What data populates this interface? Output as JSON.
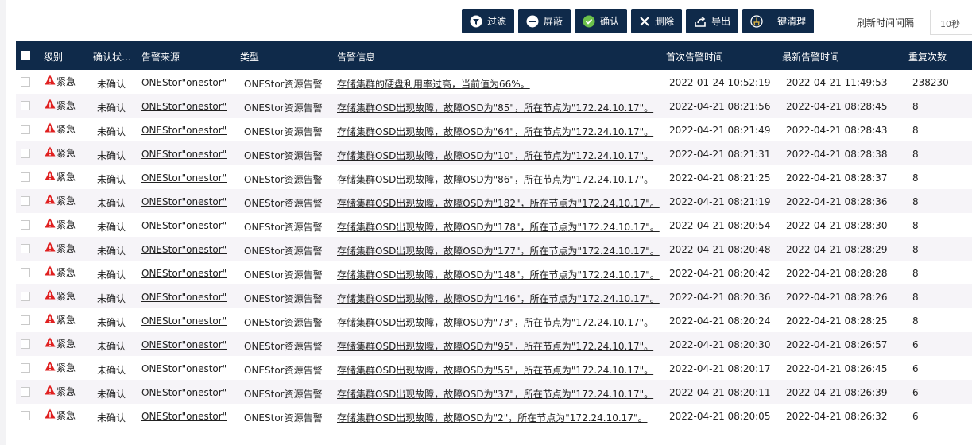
{
  "toolbar": {
    "filter_label": "过滤",
    "mask_label": "屏蔽",
    "confirm_label": "确认",
    "delete_label": "删除",
    "export_label": "导出",
    "clear_label": "一键清理",
    "refresh_label": "刷新时间间隔",
    "refresh_value": "10秒"
  },
  "colors": {
    "header_bg": "#0f2a4a",
    "button_bg": "#0f2a4a",
    "alert_red": "#e02020",
    "confirm_green": "#6cc14a"
  },
  "table": {
    "headers": {
      "level": "级别",
      "status": "确认状…",
      "source": "告警来源",
      "type": "类型",
      "msg": "告警信息",
      "first": "首次告警时间",
      "last": "最新告警时间",
      "count": "重复次数"
    },
    "rows": [
      {
        "level": "紧急",
        "status": "未确认",
        "source": "ONEStor\"onestor\"",
        "type": "ONEStor资源告警",
        "msg": "存储集群的硬盘利用率过高，当前值为66%。",
        "first": "2022-01-24 10:52:19",
        "last": "2022-04-21 11:49:53",
        "count": "238230"
      },
      {
        "level": "紧急",
        "status": "未确认",
        "source": "ONEStor\"onestor\"",
        "type": "ONEStor资源告警",
        "msg": "存储集群OSD出现故障，故障OSD为\"85\"，所在节点为\"172.24.10.17\"。",
        "first": "2022-04-21 08:21:56",
        "last": "2022-04-21 08:28:45",
        "count": "8"
      },
      {
        "level": "紧急",
        "status": "未确认",
        "source": "ONEStor\"onestor\"",
        "type": "ONEStor资源告警",
        "msg": "存储集群OSD出现故障，故障OSD为\"64\"，所在节点为\"172.24.10.17\"。",
        "first": "2022-04-21 08:21:49",
        "last": "2022-04-21 08:28:43",
        "count": "8"
      },
      {
        "level": "紧急",
        "status": "未确认",
        "source": "ONEStor\"onestor\"",
        "type": "ONEStor资源告警",
        "msg": "存储集群OSD出现故障，故障OSD为\"10\"，所在节点为\"172.24.10.17\"。",
        "first": "2022-04-21 08:21:31",
        "last": "2022-04-21 08:28:38",
        "count": "8"
      },
      {
        "level": "紧急",
        "status": "未确认",
        "source": "ONEStor\"onestor\"",
        "type": "ONEStor资源告警",
        "msg": "存储集群OSD出现故障，故障OSD为\"86\"，所在节点为\"172.24.10.17\"。",
        "first": "2022-04-21 08:21:25",
        "last": "2022-04-21 08:28:37",
        "count": "8"
      },
      {
        "level": "紧急",
        "status": "未确认",
        "source": "ONEStor\"onestor\"",
        "type": "ONEStor资源告警",
        "msg": "存储集群OSD出现故障，故障OSD为\"182\"，所在节点为\"172.24.10.17\"。",
        "first": "2022-04-21 08:21:19",
        "last": "2022-04-21 08:28:36",
        "count": "8"
      },
      {
        "level": "紧急",
        "status": "未确认",
        "source": "ONEStor\"onestor\"",
        "type": "ONEStor资源告警",
        "msg": "存储集群OSD出现故障，故障OSD为\"178\"，所在节点为\"172.24.10.17\"。",
        "first": "2022-04-21 08:20:54",
        "last": "2022-04-21 08:28:30",
        "count": "8"
      },
      {
        "level": "紧急",
        "status": "未确认",
        "source": "ONEStor\"onestor\"",
        "type": "ONEStor资源告警",
        "msg": "存储集群OSD出现故障，故障OSD为\"177\"，所在节点为\"172.24.10.17\"。",
        "first": "2022-04-21 08:20:48",
        "last": "2022-04-21 08:28:29",
        "count": "8"
      },
      {
        "level": "紧急",
        "status": "未确认",
        "source": "ONEStor\"onestor\"",
        "type": "ONEStor资源告警",
        "msg": "存储集群OSD出现故障，故障OSD为\"148\"，所在节点为\"172.24.10.17\"。",
        "first": "2022-04-21 08:20:42",
        "last": "2022-04-21 08:28:28",
        "count": "8"
      },
      {
        "level": "紧急",
        "status": "未确认",
        "source": "ONEStor\"onestor\"",
        "type": "ONEStor资源告警",
        "msg": "存储集群OSD出现故障，故障OSD为\"146\"，所在节点为\"172.24.10.17\"。",
        "first": "2022-04-21 08:20:36",
        "last": "2022-04-21 08:28:26",
        "count": "8"
      },
      {
        "level": "紧急",
        "status": "未确认",
        "source": "ONEStor\"onestor\"",
        "type": "ONEStor资源告警",
        "msg": "存储集群OSD出现故障，故障OSD为\"73\"，所在节点为\"172.24.10.17\"。",
        "first": "2022-04-21 08:20:24",
        "last": "2022-04-21 08:28:25",
        "count": "8"
      },
      {
        "level": "紧急",
        "status": "未确认",
        "source": "ONEStor\"onestor\"",
        "type": "ONEStor资源告警",
        "msg": "存储集群OSD出现故障，故障OSD为\"95\"，所在节点为\"172.24.10.17\"。",
        "first": "2022-04-21 08:20:30",
        "last": "2022-04-21 08:26:57",
        "count": "6"
      },
      {
        "level": "紧急",
        "status": "未确认",
        "source": "ONEStor\"onestor\"",
        "type": "ONEStor资源告警",
        "msg": "存储集群OSD出现故障，故障OSD为\"55\"，所在节点为\"172.24.10.17\"。",
        "first": "2022-04-21 08:20:17",
        "last": "2022-04-21 08:26:45",
        "count": "6"
      },
      {
        "level": "紧急",
        "status": "未确认",
        "source": "ONEStor\"onestor\"",
        "type": "ONEStor资源告警",
        "msg": "存储集群OSD出现故障，故障OSD为\"37\"，所在节点为\"172.24.10.17\"。",
        "first": "2022-04-21 08:20:11",
        "last": "2022-04-21 08:26:39",
        "count": "6"
      },
      {
        "level": "紧急",
        "status": "未确认",
        "source": "ONEStor\"onestor\"",
        "type": "ONEStor资源告警",
        "msg": "存储集群OSD出现故障，故障OSD为\"2\"，所在节点为\"172.24.10.17\"。",
        "first": "2022-04-21 08:20:05",
        "last": "2022-04-21 08:26:32",
        "count": "6"
      }
    ]
  }
}
